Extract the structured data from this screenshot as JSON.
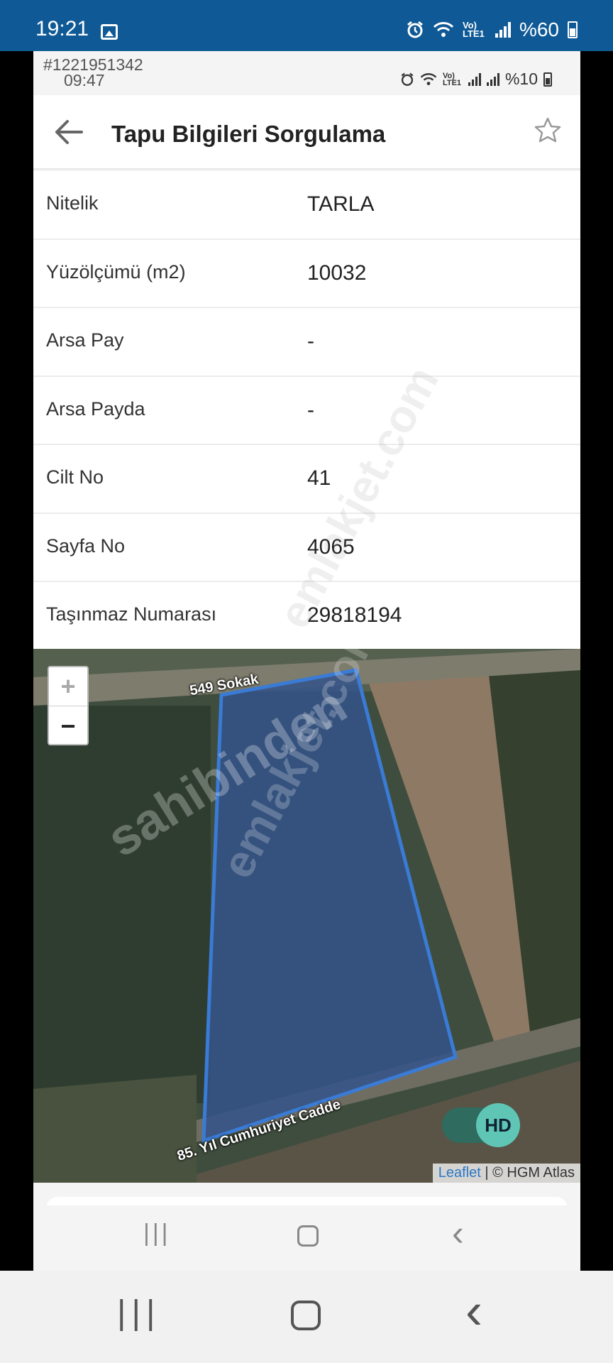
{
  "outer_status": {
    "time": "19:21",
    "battery_text": "%60",
    "network_label": "Vo) LTE1",
    "icons": [
      "image-icon",
      "alarm-icon",
      "wifi-icon",
      "signal-icon",
      "battery-icon"
    ]
  },
  "inner_status": {
    "listing_id": "#1221951342",
    "time": "09:47",
    "network_label": "Vo) LTE1",
    "battery_text": "%10"
  },
  "appbar": {
    "title": "Tapu Bilgileri Sorgulama",
    "icons": [
      "back-arrow-icon",
      "star-icon"
    ]
  },
  "details": [
    {
      "label": "Nitelik",
      "value": "TARLA"
    },
    {
      "label": "Yüzölçümü (m2)",
      "value": "10032"
    },
    {
      "label": "Arsa Pay",
      "value": "-"
    },
    {
      "label": "Arsa Payda",
      "value": "-"
    },
    {
      "label": "Cilt No",
      "value": "41"
    },
    {
      "label": "Sayfa No",
      "value": "4065"
    },
    {
      "label": "Taşınmaz Numarası",
      "value": "29818194"
    }
  ],
  "map": {
    "zoom_in": "+",
    "zoom_out": "−",
    "road_top": "549 Sokak",
    "road_bottom": "85. Yıl Cumhuriyet Cadde",
    "attribution_link": "Leaflet",
    "attribution_rest": " | © HGM Atlas",
    "parcel_color": "#3a7bd5"
  },
  "hd_toggle": {
    "label": "HD"
  },
  "watermarks": [
    "sahibinden",
    "emlakjet.com"
  ],
  "nav": {
    "recent": "|||",
    "home": "○",
    "back": "‹"
  }
}
